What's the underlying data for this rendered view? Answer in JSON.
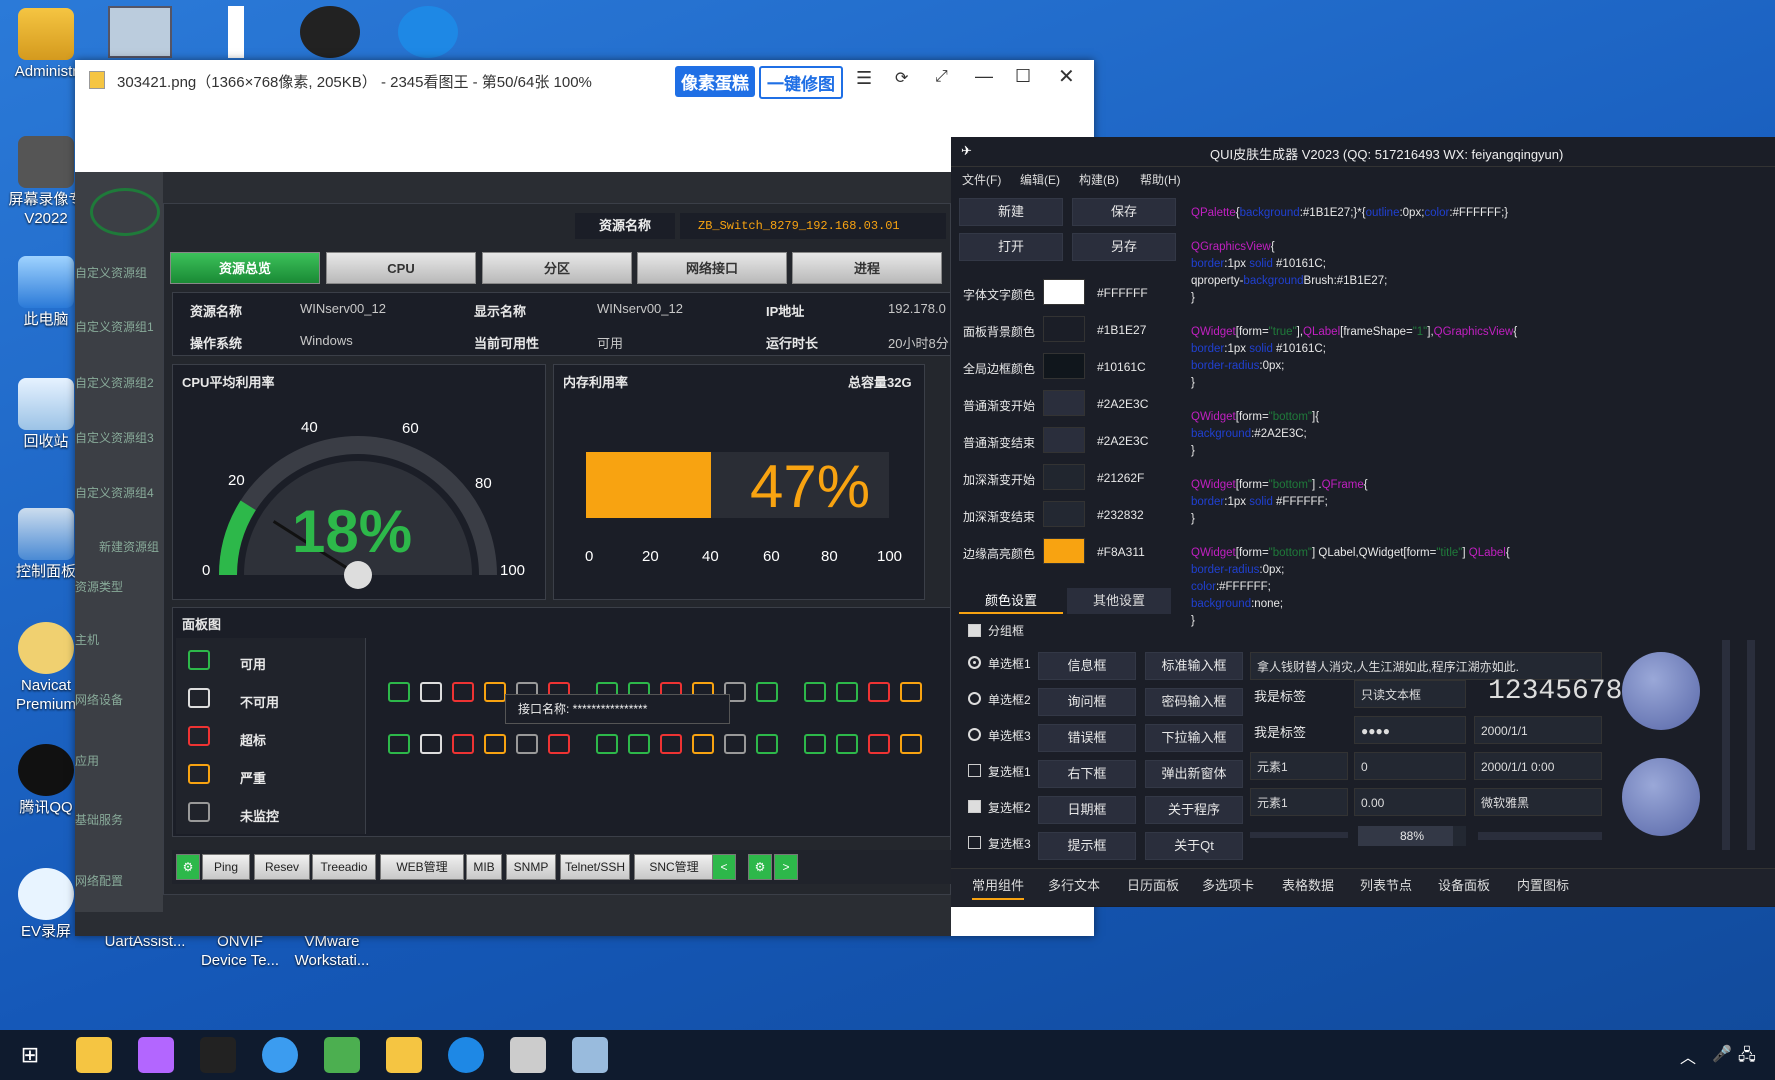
{
  "desktop": {
    "icons": [
      {
        "label": "Administr",
        "x": "0",
        "y": "10"
      },
      {
        "label": "屏幕录像专",
        "label2": "V2022"
      },
      {
        "label": "此电脑"
      },
      {
        "label": "回收站"
      },
      {
        "label": "控制面板"
      },
      {
        "label": "Navicat",
        "label2": "Premium"
      },
      {
        "label": "腾讯QQ"
      },
      {
        "label": "EV录屏"
      },
      {
        "label": "UartAssist..."
      },
      {
        "label": "ONVIF",
        "label2": "Device Te..."
      },
      {
        "label": "VMware",
        "label2": "Workstati..."
      }
    ]
  },
  "viewer": {
    "title": "303421.png（1366×768像素, 205KB） - 2345看图王 - 第50/64张 100%",
    "btn1": "像素蛋糕",
    "btn2": "一键修图"
  },
  "app": {
    "resource_label": "资源名称",
    "resource_value": "ZB_Switch_8279_192.168.03.01",
    "tabs": [
      "资源总览",
      "CPU",
      "分区",
      "网络接口",
      "进程"
    ],
    "info": {
      "r1": [
        "资源名称",
        "WINserv00_12",
        "显示名称",
        "WINserv00_12",
        "IP地址",
        "192.178.0"
      ],
      "r2": [
        "操作系统",
        "Windows",
        "当前可用性",
        "可用",
        "运行时长",
        "20小时8分"
      ]
    },
    "cpu": {
      "title": "CPU平均利用率",
      "value": "18%",
      "percent": 18,
      "ticks": [
        "0",
        "20",
        "40",
        "60",
        "80",
        "100"
      ]
    },
    "mem": {
      "title": "内存利用率",
      "total": "总容量32G",
      "value": "47%",
      "percent": 47,
      "ticks": [
        "0",
        "20",
        "40",
        "60",
        "80",
        "100"
      ]
    },
    "panel_title": "面板图",
    "legend": [
      "可用",
      "不可用",
      "超标",
      "严重",
      "未监控"
    ],
    "tooltip": "接口名称: ****************",
    "tools": [
      "Ping",
      "Resev",
      "Treeadio",
      "WEB管理",
      "MIB",
      "SNMP",
      "Telnet/SSH",
      "SNC管理"
    ],
    "nav": [
      "自定义资源组",
      "自定义资源组1",
      "自定义资源组2",
      "自定义资源组3",
      "自定义资源组4",
      "新建资源组",
      "资源类型",
      "主机",
      "网络设备",
      "应用",
      "基础服务",
      "网络配置"
    ]
  },
  "qui": {
    "title": "QUI皮肤生成器 V2023 (QQ: 517216493 WX: feiyangqingyun)",
    "menu": [
      "文件(F)",
      "编辑(E)",
      "构建(B)",
      "帮助(H)"
    ],
    "buttons": [
      "新建",
      "保存",
      "打开",
      "另存"
    ],
    "colors": [
      {
        "label": "字体文字颜色",
        "hex": "#FFFFFF"
      },
      {
        "label": "面板背景颜色",
        "hex": "#1B1E27"
      },
      {
        "label": "全局边框颜色",
        "hex": "#10161C"
      },
      {
        "label": "普通渐变开始",
        "hex": "#2A2E3C"
      },
      {
        "label": "普通渐变结束",
        "hex": "#2A2E3C"
      },
      {
        "label": "加深渐变开始",
        "hex": "#21262F"
      },
      {
        "label": "加深渐变结束",
        "hex": "#232832"
      },
      {
        "label": "边缘高亮颜色",
        "hex": "#F8A311"
      }
    ],
    "tabs": [
      "颜色设置",
      "其他设置"
    ],
    "group": "分组框",
    "radios": [
      "单选框1",
      "单选框2",
      "单选框3"
    ],
    "checks": [
      "复选框1",
      "复选框2",
      "复选框3"
    ],
    "col1": [
      "信息框",
      "询问框",
      "错误框",
      "右下框",
      "日期框",
      "提示框"
    ],
    "col2": [
      "标准输入框",
      "密码输入框",
      "下拉输入框",
      "弹出新窗体",
      "关于程序",
      "关于Qt"
    ],
    "text_line": "拿人钱财替人消灾,人生江湖如此,程序江湖亦如此.",
    "label1": "我是标签",
    "readonly": "只读文本框",
    "lcd": "12345678",
    "label2": "我是标签",
    "password": "●●●●",
    "date": "2000/1/1",
    "combo1": "元素1",
    "spin1": "0",
    "datetime": "2000/1/1 0:00",
    "combo2": "元素1",
    "spin2": "0.00",
    "font": "微软雅黑",
    "progress": "88%",
    "progress_value": 88,
    "bottom_tabs": [
      "常用组件",
      "多行文本",
      "日历面板",
      "多选项卡",
      "表格数据",
      "列表节点",
      "设备面板",
      "内置图标"
    ]
  }
}
